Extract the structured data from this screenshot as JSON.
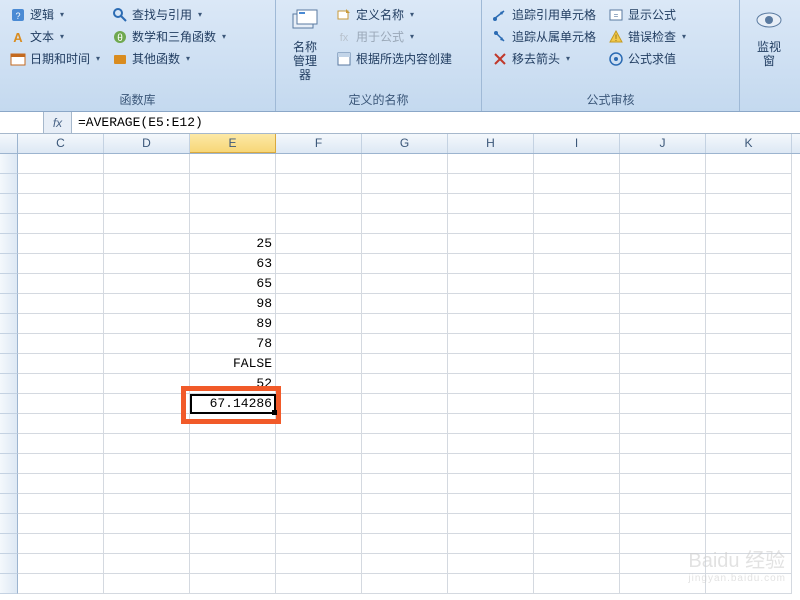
{
  "ribbon": {
    "groups": {
      "func_lib": {
        "label": "函数库",
        "items": {
          "logic": "逻辑",
          "text": "文本",
          "datetime": "日期和时间",
          "lookup": "查找与引用",
          "math": "数学和三角函数",
          "other": "其他函数"
        }
      },
      "defined_names": {
        "label": "定义的名称",
        "name_manager": "名称\n管理器",
        "define_name": "定义名称",
        "use_in_formula": "用于公式",
        "create_from_selection": "根据所选内容创建"
      },
      "formula_audit": {
        "label": "公式审核",
        "trace_precedents": "追踪引用单元格",
        "trace_dependents": "追踪从属单元格",
        "remove_arrows": "移去箭头",
        "show_formulas": "显示公式",
        "error_check": "错误检查",
        "evaluate": "公式求值"
      },
      "watch": {
        "label": "监视窗"
      }
    }
  },
  "formula_bar": {
    "fx": "fx",
    "formula": "=AVERAGE(E5:E12)"
  },
  "columns": [
    "C",
    "D",
    "E",
    "F",
    "G",
    "H",
    "I",
    "J",
    "K"
  ],
  "selected_column_index": 2,
  "chart_data": {
    "type": "table",
    "columns": [
      "E"
    ],
    "rows": [
      {
        "E": 25
      },
      {
        "E": 63
      },
      {
        "E": 65
      },
      {
        "E": 98
      },
      {
        "E": 89
      },
      {
        "E": 78
      },
      {
        "E": "FALSE"
      },
      {
        "E": 52
      },
      {
        "E": 67.14286
      }
    ],
    "result_cell": "E13",
    "formula": "=AVERAGE(E5:E12)"
  },
  "cells": {
    "E": [
      "",
      "",
      "",
      "",
      "25",
      "63",
      "65",
      "98",
      "89",
      "78",
      "FALSE",
      "52",
      "67.14286",
      "",
      "",
      "",
      "",
      "",
      "",
      "",
      "",
      ""
    ]
  },
  "watermark": {
    "main": "Baidu 经验",
    "sub": "jingyan.baidu.com"
  }
}
